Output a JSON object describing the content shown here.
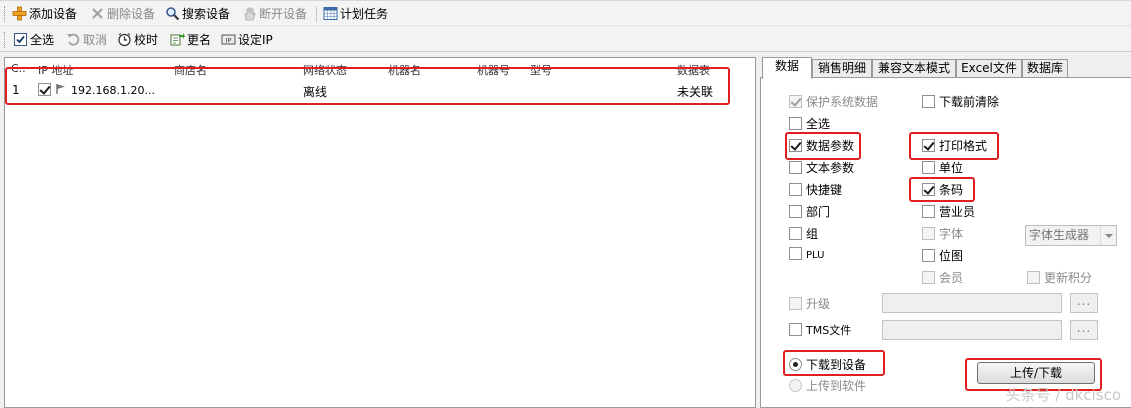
{
  "toolbar1": {
    "add": "添加设备",
    "delete": "删除设备",
    "search": "搜索设备",
    "disconnect": "断开设备",
    "schedule": "计划任务"
  },
  "toolbar2": {
    "select_all": "全选",
    "cancel": "取消",
    "time_sync": "校时",
    "rename": "更名",
    "set_ip": "设定IP"
  },
  "device_table": {
    "columns": [
      "C..",
      "IP 地址",
      "商店名",
      "网络状态",
      "机器名",
      "机器号",
      "型号",
      "数据表"
    ],
    "rows": [
      {
        "index": "1",
        "ip": "192.168.1.20...",
        "shop": "",
        "status": "离线",
        "machine_name": "",
        "machine_no": "",
        "model": "",
        "table": "未关联"
      }
    ]
  },
  "tabs": [
    "数据",
    "销售明细",
    "兼容文本模式",
    "Excel文件",
    "数据库"
  ],
  "data_tab": {
    "protect_system": "保护系统数据",
    "clear_before_download": "下载前清除",
    "select_all": "全选",
    "data_params": "数据参数",
    "print_format": "打印格式",
    "text_params": "文本参数",
    "unit": "单位",
    "hotkey": "快捷键",
    "barcode": "条码",
    "department": "部门",
    "salesperson": "营业员",
    "group": "组",
    "font": "字体",
    "font_generator": "字体生成器",
    "plu": "PLU",
    "bitmap": "位图",
    "member": "会员",
    "update_points": "更新积分",
    "upgrade": "升级",
    "tms_file": "TMS文件",
    "ellipsis": "...",
    "download_to_device": "下载到设备",
    "upload_to_software": "上传到软件",
    "upload_download_button": "上传/下载"
  },
  "watermark": "头条号 / dkcisco",
  "colors": {
    "highlight": "#e02020"
  }
}
